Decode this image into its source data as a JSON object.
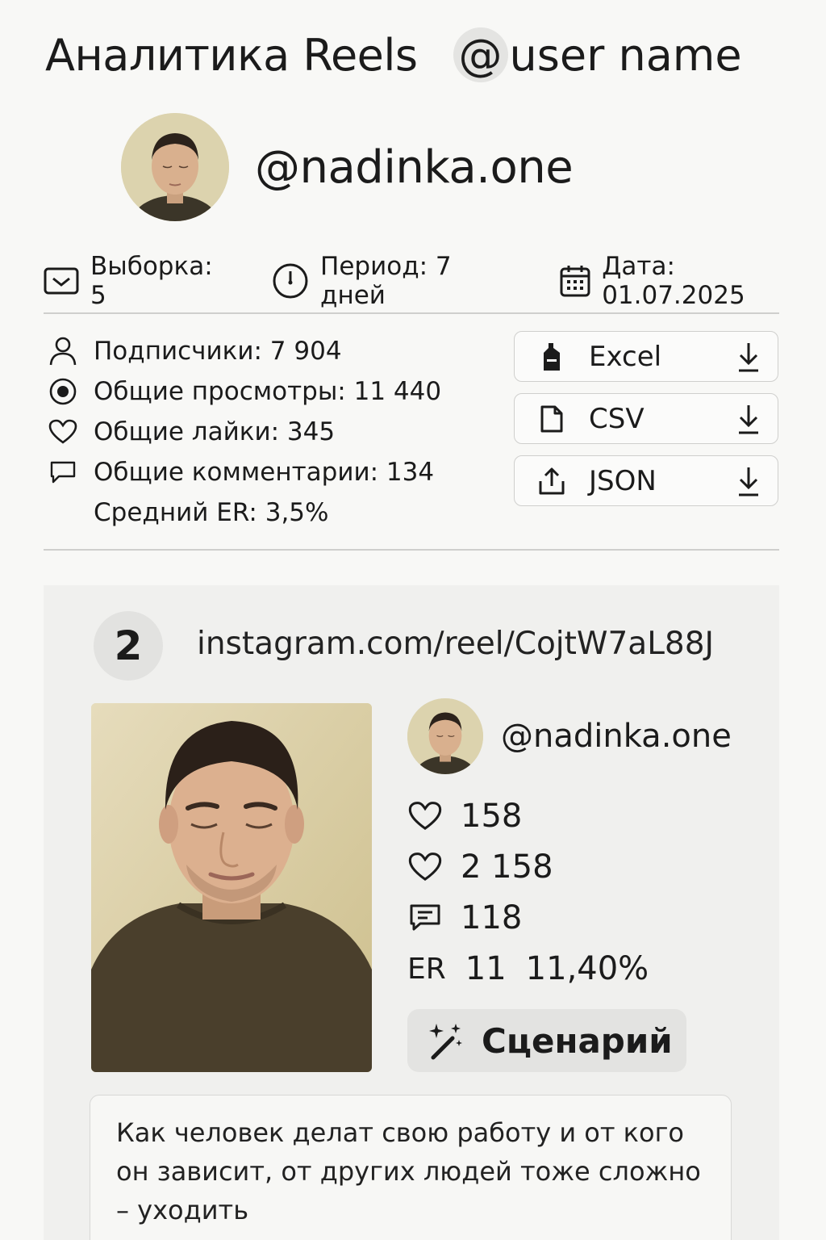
{
  "header": {
    "title": "Аналитика Reels",
    "at_symbol": "@",
    "username_placeholder": "user name"
  },
  "profile": {
    "handle": "@nadinka.one",
    "avatar_icon": "avatar-photo"
  },
  "meta": {
    "sample": "Выборка: 5",
    "period": "Период: 7 дней",
    "date": "Дата: 01.07.2025"
  },
  "stats": {
    "followers": "Подписчики: 7 904",
    "views": "Общие просмотры: 11 440",
    "likes": "Общие лайки: 345",
    "comments": "Общие комментарии: 134",
    "avg_er": "Средний ER: 3,5%"
  },
  "exports": [
    {
      "label": "Excel",
      "icon": "excel-icon"
    },
    {
      "label": "CSV",
      "icon": "csv-file-icon"
    },
    {
      "label": "JSON",
      "icon": "upload-icon"
    }
  ],
  "reel": {
    "number": "2",
    "url": "instagram.com/reel/CojtW7aL88J",
    "handle": "@nadinka.one",
    "likes": "158",
    "likes_total": "2 158",
    "comments": "118",
    "er_label": "ER",
    "er_value": "11",
    "er_percent": "11,40%",
    "scenario_label": "Сценарий",
    "caption_line1": "Как человек делат свою работу и от кого",
    "caption_line2": "он зависит, от других людей тоже сложно",
    "caption_line3": "– уходить"
  },
  "colors": {
    "background": "#f8f8f6",
    "card": "#f0f0ee",
    "text": "#1b1b1b",
    "divider": "#cfcfcd"
  }
}
